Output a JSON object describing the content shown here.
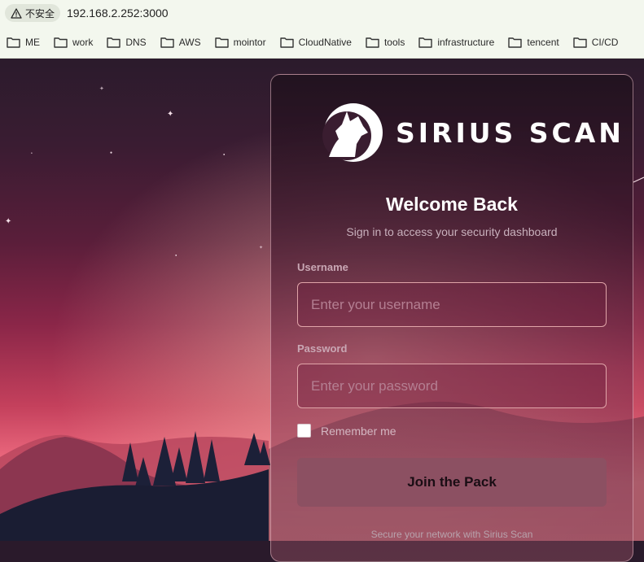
{
  "browser": {
    "security_label": "不安全",
    "url": "192.168.2.252:3000",
    "bookmarks": [
      "ME",
      "work",
      "DNS",
      "AWS",
      "mointor",
      "CloudNative",
      "tools",
      "infrastructure",
      "tencent",
      "CI/CD"
    ]
  },
  "login": {
    "brand": "SIRIUS SCAN",
    "title": "Welcome Back",
    "subtitle": "Sign in to access your security dashboard",
    "username_label": "Username",
    "username_placeholder": "Enter your username",
    "password_label": "Password",
    "password_placeholder": "Enter your password",
    "remember_label": "Remember me",
    "submit_label": "Join the Pack",
    "footer": "Secure your network with Sirius Scan"
  },
  "colors": {
    "accent": "#8c5062",
    "field_border": "#e0a4a8",
    "bookmark_bar_bg": "#f3f7ee"
  }
}
